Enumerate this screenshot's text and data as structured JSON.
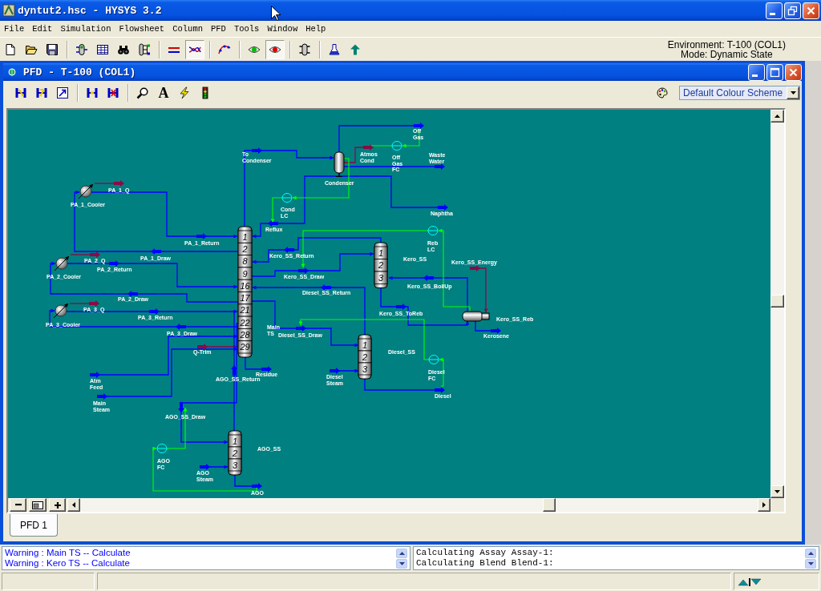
{
  "window": {
    "title": "dyntut2.hsc - HYSYS 3.2"
  },
  "menu": [
    "File",
    "Edit",
    "Simulation",
    "Flowsheet",
    "Column",
    "PFD",
    "Tools",
    "Window",
    "Help"
  ],
  "toolbar": [
    {
      "pressed": false
    },
    {
      "pressed": false
    },
    {
      "pressed": false
    },
    {
      "pressed": false
    },
    {
      "pressed": false
    },
    {
      "pressed": false
    },
    {
      "pressed": false
    },
    {
      "pressed": false
    },
    {
      "pressed": true
    },
    {
      "pressed": false
    },
    {
      "pressed": false
    },
    {
      "pressed": true
    },
    {
      "pressed": false
    },
    {
      "pressed": false
    },
    {
      "pressed": false
    }
  ],
  "environment": {
    "label": "Environment: T-100 (COL1)",
    "mode": "Mode: Dynamic State"
  },
  "pfd_window": {
    "title": "PFD - T-100 (COL1)",
    "text_tool": "A",
    "colour_scheme": "Default Colour Scheme",
    "flowsheet": {
      "columns": [
        {
          "label": "Main TS",
          "stages": [
            "1",
            "2",
            "8",
            "9",
            "16",
            "17",
            "21",
            "22",
            "28",
            "29"
          ]
        },
        {
          "label": "Kero_SS",
          "stages": [
            "1",
            "2",
            "3"
          ]
        },
        {
          "label": "Diesel_SS",
          "stages": [
            "1",
            "2",
            "3"
          ]
        },
        {
          "label": "AGO_SS",
          "stages": [
            "1",
            "2",
            "3"
          ]
        }
      ],
      "condenser": {
        "label": "Condenser"
      },
      "reboiler": {
        "label": "Kero_SS_Reb"
      },
      "coolers": [
        {
          "label": "PA_1_Cooler"
        },
        {
          "label": "PA_2_Cooler"
        },
        {
          "label": "PA_3_Cooler"
        }
      ],
      "controllers": [
        {
          "label": "Off Gas FC"
        },
        {
          "label": "Cond LC"
        },
        {
          "label": "Reb LC"
        },
        {
          "label": "Diesel FC"
        },
        {
          "label": "AGO FC"
        }
      ],
      "streams": [
        {
          "label": "To Condenser",
          "kind": "material"
        },
        {
          "label": "Off Gas",
          "kind": "material"
        },
        {
          "label": "Atmos Cond",
          "kind": "energy"
        },
        {
          "label": "Waste Water",
          "kind": "material"
        },
        {
          "label": "Naphtha",
          "kind": "material"
        },
        {
          "label": "Reflux",
          "kind": "material"
        },
        {
          "label": "PA_1_Q",
          "kind": "energy"
        },
        {
          "label": "PA_1_Return",
          "kind": "material"
        },
        {
          "label": "PA_1_Draw",
          "kind": "material"
        },
        {
          "label": "PA_2_Q",
          "kind": "energy"
        },
        {
          "label": "PA_2_Return",
          "kind": "material"
        },
        {
          "label": "PA_2_Draw",
          "kind": "material"
        },
        {
          "label": "PA_3_Q",
          "kind": "energy"
        },
        {
          "label": "PA_3_Return",
          "kind": "material"
        },
        {
          "label": "PA_3_Draw",
          "kind": "material"
        },
        {
          "label": "Q-Trim",
          "kind": "energy"
        },
        {
          "label": "Atm Feed",
          "kind": "material"
        },
        {
          "label": "Main Steam",
          "kind": "material"
        },
        {
          "label": "Residue",
          "kind": "material"
        },
        {
          "label": "AGO_SS_Return",
          "kind": "material"
        },
        {
          "label": "AGO_SS_Draw",
          "kind": "material"
        },
        {
          "label": "AGO Steam",
          "kind": "material"
        },
        {
          "label": "AGO",
          "kind": "material"
        },
        {
          "label": "Kero_SS_Return",
          "kind": "material"
        },
        {
          "label": "Kero_SS_Draw",
          "kind": "material"
        },
        {
          "label": "Kero_SS_BoilUp",
          "kind": "material"
        },
        {
          "label": "Kero_SS_Energy",
          "kind": "energy"
        },
        {
          "label": "Kero_SS_ToReb",
          "kind": "material"
        },
        {
          "label": "Kerosene",
          "kind": "material"
        },
        {
          "label": "Diesel_SS_Return",
          "kind": "material"
        },
        {
          "label": "Diesel_SS_Draw",
          "kind": "material"
        },
        {
          "label": "Diesel Steam",
          "kind": "material"
        },
        {
          "label": "Diesel",
          "kind": "material"
        }
      ]
    },
    "tabs": [
      {
        "label": "PFD 1",
        "selected": true
      }
    ]
  },
  "messages": {
    "warnings": [
      "Warning : Main TS -- Calculate",
      "Warning : Kero TS -- Calculate"
    ],
    "trace": [
      "Calculating Assay Assay-1:",
      "Calculating Blend Blend-1:"
    ]
  }
}
